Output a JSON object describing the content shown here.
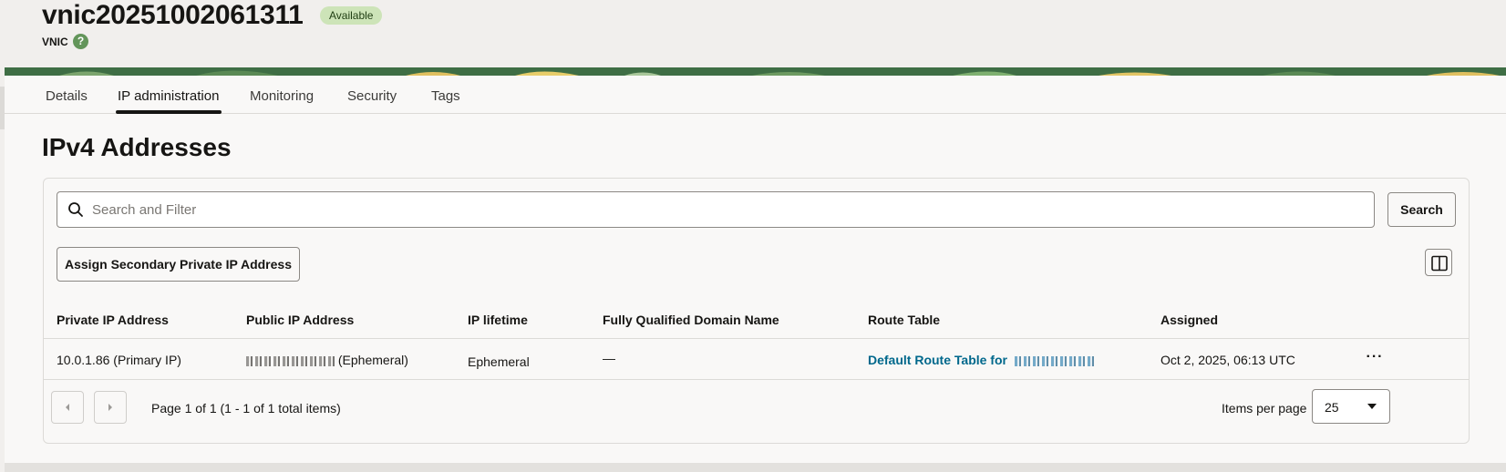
{
  "header": {
    "title": "vnic20251002061311",
    "status_badge": "Available",
    "subtitle": "VNIC",
    "help_icon": "?"
  },
  "tabs": [
    {
      "label": "Details",
      "active": false
    },
    {
      "label": "IP administration",
      "active": true
    },
    {
      "label": "Monitoring",
      "active": false
    },
    {
      "label": "Security",
      "active": false
    },
    {
      "label": "Tags",
      "active": false
    }
  ],
  "section": {
    "title": "IPv4 Addresses"
  },
  "search": {
    "placeholder": "Search and Filter",
    "button_label": "Search"
  },
  "toolbar": {
    "assign_label": "Assign Secondary Private IP Address"
  },
  "table": {
    "columns": [
      "Private IP Address",
      "Public IP Address",
      "IP lifetime",
      "Fully Qualified Domain Name",
      "Route Table",
      "Assigned"
    ],
    "rows": [
      {
        "private_ip": "10.0.1.86 (Primary IP)",
        "public_ip_suffix": "(Ephemeral)",
        "lifetime": "Ephemeral",
        "fqdn": "—",
        "route_table": "Default Route Table for",
        "assigned": "Oct 2, 2025, 06:13 UTC",
        "actions": "···"
      }
    ]
  },
  "pagination": {
    "info": "Page 1 of 1 (1 - 1 of 1 total items)",
    "items_per_page_label": "Items per page",
    "items_per_page_value": "25"
  },
  "colors": {
    "badge_bg": "#cde4b8",
    "link": "#00688c",
    "help_icon": "#63955a",
    "banner": "#3f6e45"
  }
}
